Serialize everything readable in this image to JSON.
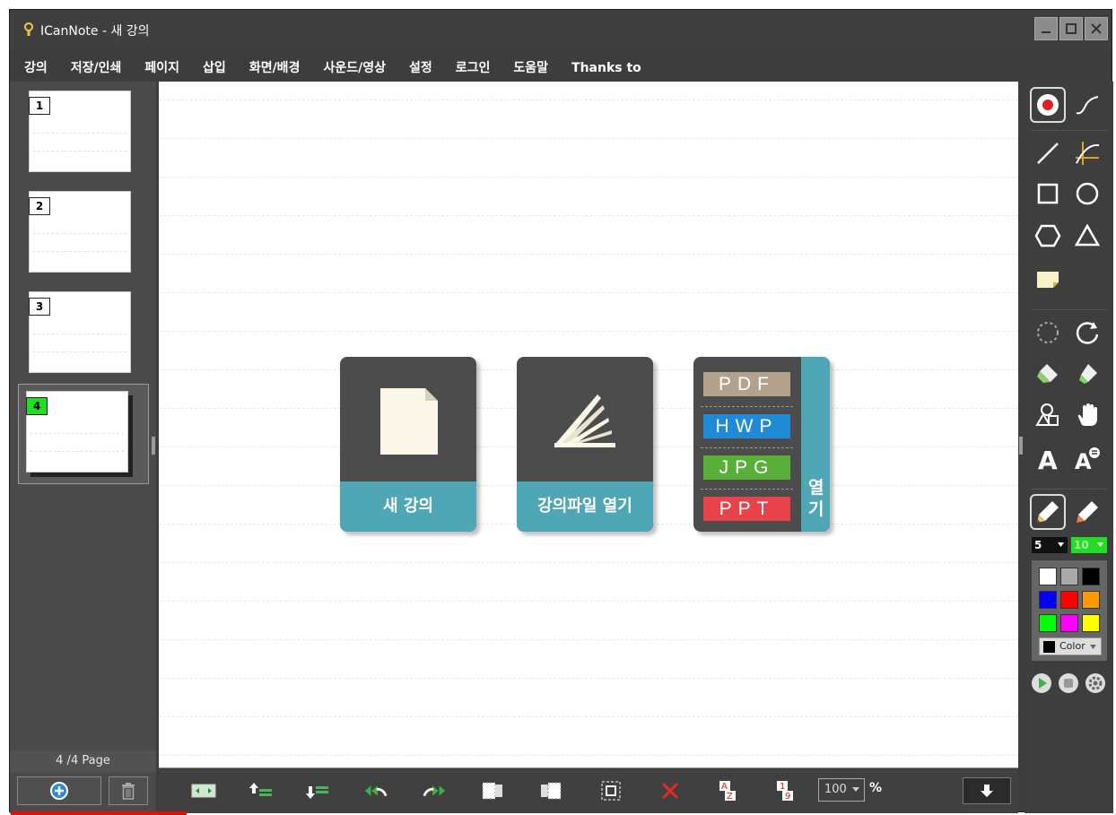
{
  "window": {
    "title": "ICanNote - 새 강의",
    "colors": {
      "frame": "#3d3d3d",
      "accent_teal": "#4fa6b4",
      "selected_page": "#22dd22"
    }
  },
  "menu": [
    "강의",
    "저장/인쇄",
    "페이지",
    "삽입",
    "화면/배경",
    "사운드/영상",
    "설정",
    "로그인",
    "도움말",
    "Thanks to"
  ],
  "pages": {
    "items": [
      "1",
      "2",
      "3",
      "4"
    ],
    "selected_index": 3,
    "counter": "4  /4 Page"
  },
  "cards": {
    "new_lecture": "새 강의",
    "open_lecture_file": "강의파일 열기",
    "open_side": [
      "열",
      "기"
    ],
    "formats": [
      {
        "label": "PDF",
        "color": "#b3a18d"
      },
      {
        "label": "HWP",
        "color": "#1f8ad6"
      },
      {
        "label": "JPG",
        "color": "#58b03a"
      },
      {
        "label": "PPT",
        "color": "#e8424a"
      }
    ]
  },
  "bottom_toolbar": {
    "zoom_value": "100",
    "zoom_unit": "%",
    "icons": [
      "fit-page-icon",
      "move-page-up-icon",
      "move-page-down-icon",
      "undo-icon",
      "redo-icon",
      "select-left-icon",
      "select-right-icon",
      "select-box-icon",
      "delete-icon",
      "sort-alpha-icon",
      "sort-number-icon",
      "scroll-down-icon"
    ]
  },
  "right_tools": {
    "pen_size": "5",
    "highlighter_size": "10",
    "color_button_label": "Color",
    "palette": [
      "#ffffff",
      "#a9a9a9",
      "#000000",
      "#0000ff",
      "#ff0000",
      "#ff9900",
      "#00ff00",
      "#ff00ff",
      "#ffff00"
    ]
  }
}
